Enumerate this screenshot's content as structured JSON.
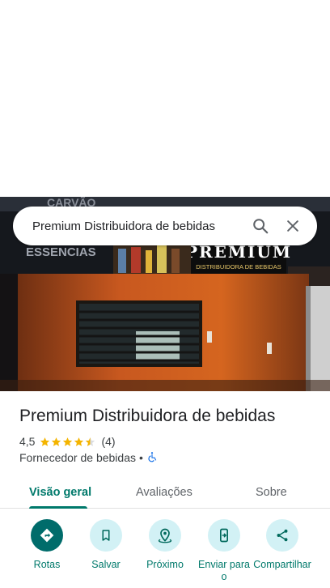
{
  "search": {
    "query": "Premium Distribuidora de bebidas",
    "search_icon": "search-icon",
    "close_icon": "close-icon"
  },
  "photo": {
    "signs": {
      "top": "CARVÃO",
      "left": "ESSENCIAS",
      "brand": "PREMIUM",
      "brand_sub": "DISTRIBUIDORA DE BEBIDAS",
      "brand_stars": "★★★★★★"
    }
  },
  "place": {
    "title": "Premium Distribuidora de bebidas",
    "rating": "4,5",
    "stars": 4.5,
    "review_count": "(4)",
    "category": "Fornecedor de bebidas",
    "separator": "•",
    "accessibility_icon": "wheelchair-icon"
  },
  "tabs": [
    {
      "label": "Visão geral",
      "active": true
    },
    {
      "label": "Avaliações",
      "active": false
    },
    {
      "label": "Sobre",
      "active": false
    }
  ],
  "actions": [
    {
      "label": "Rotas",
      "icon": "directions-icon"
    },
    {
      "label": "Salvar",
      "icon": "bookmark-icon"
    },
    {
      "label": "Próximo",
      "icon": "nearby-icon"
    },
    {
      "label": "Enviar para o",
      "icon": "send-to-phone-icon"
    },
    {
      "label": "Compartilhar",
      "icon": "share-icon"
    }
  ],
  "colors": {
    "accent": "#00796b",
    "primary_button": "#006c6b",
    "action_bg": "#d2f1f5",
    "star": "#f4b400"
  }
}
